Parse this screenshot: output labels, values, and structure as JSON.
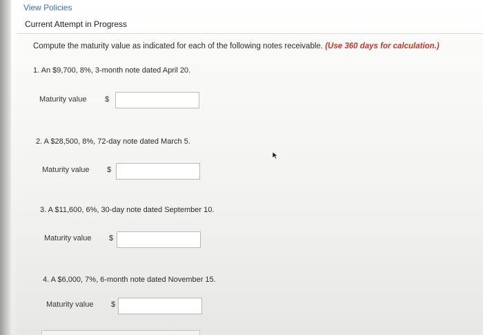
{
  "header": {
    "view_policies": "View Policies",
    "attempt_status": "Current Attempt in Progress"
  },
  "instructions": {
    "text": "Compute the maturity value as indicated for each of the following notes receivable.",
    "note": "(Use 360 days for calculation.)"
  },
  "questions": [
    {
      "text": "1. An $9,700, 8%, 3-month note dated April 20.",
      "label": "Maturity value",
      "currency": "$",
      "value": ""
    },
    {
      "text": "2. A $28,500, 8%, 72-day note dated March 5.",
      "label": "Maturity value",
      "currency": "$",
      "value": ""
    },
    {
      "text": "3. A $11,600, 6%, 30-day note dated September 10.",
      "label": "Maturity value",
      "currency": "$",
      "value": ""
    },
    {
      "text": "4. A $6,000, 7%, 6-month note dated November 15.",
      "label": "Maturity value",
      "currency": "$",
      "value": ""
    }
  ],
  "icons": {
    "pointer": "mouse-pointer-icon"
  }
}
